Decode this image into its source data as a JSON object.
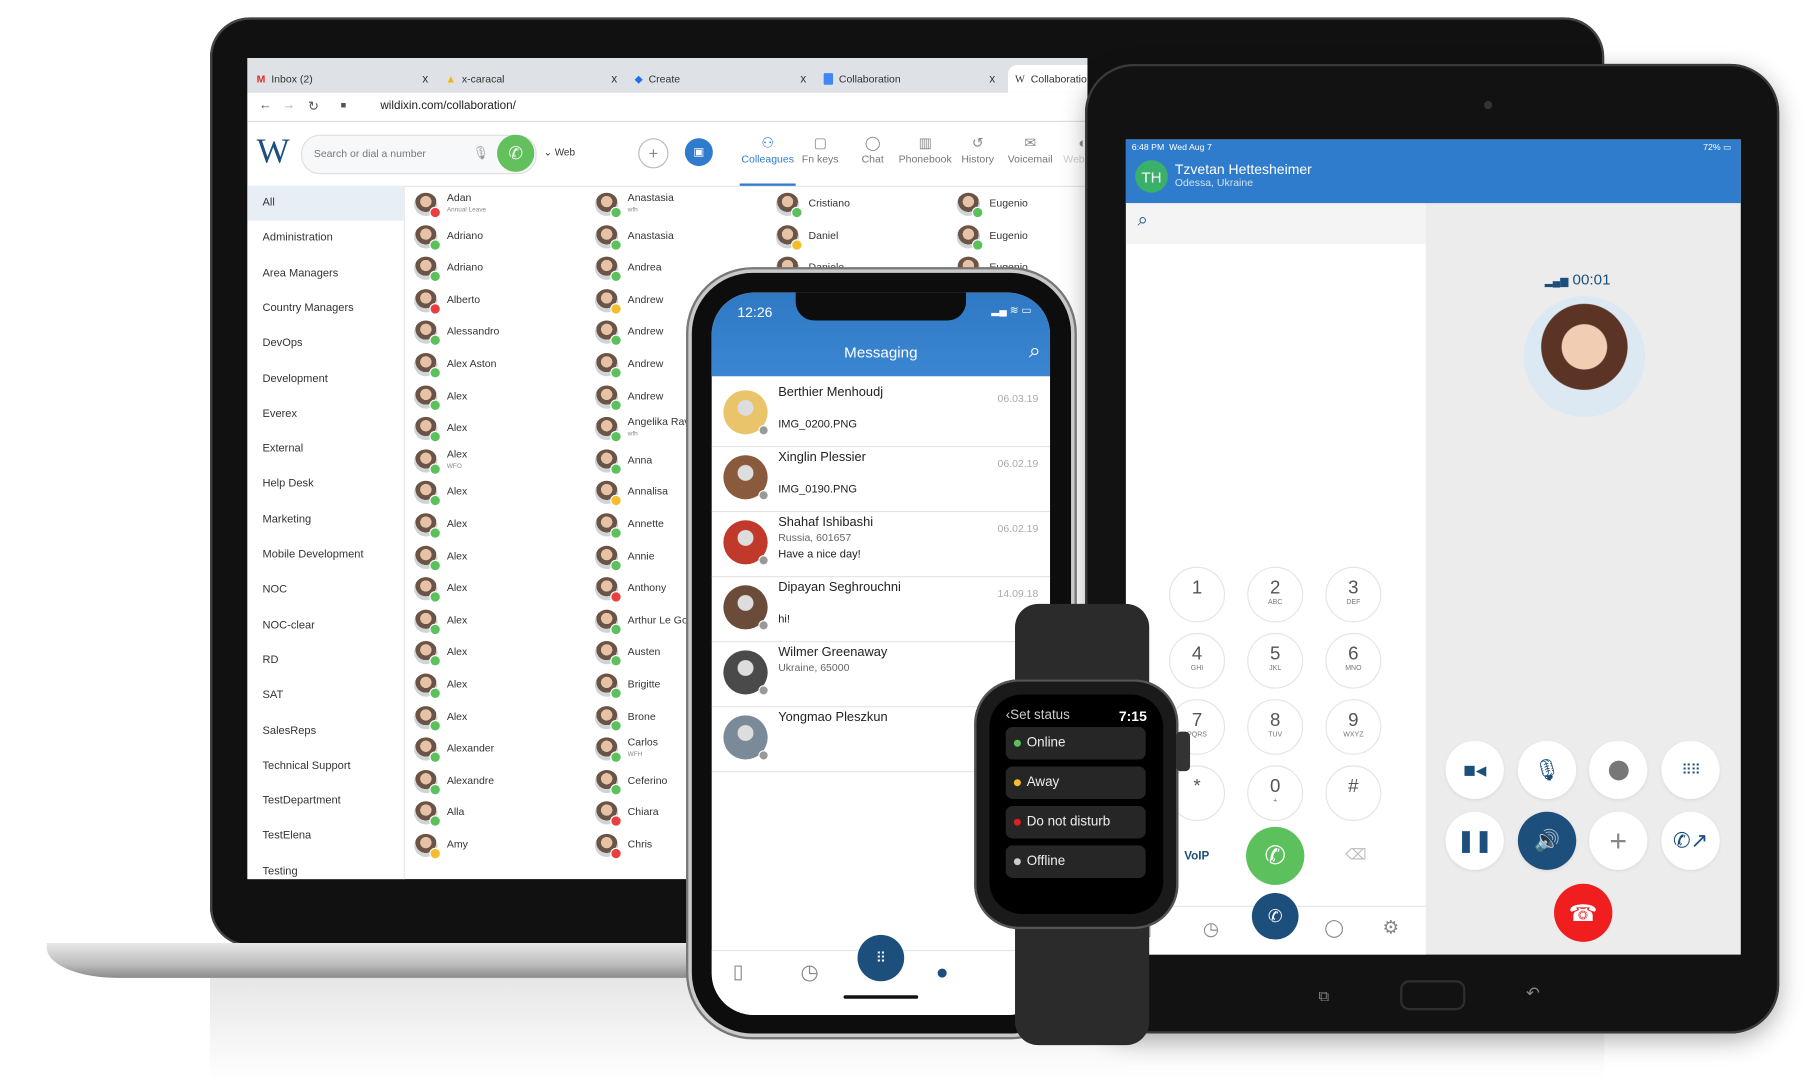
{
  "browser": {
    "tabs": [
      {
        "label": "Inbox (2)",
        "icon": "gmail-icon",
        "color": "#d93025"
      },
      {
        "label": "x-caracal",
        "icon": "drive-icon",
        "color": "#f4b400"
      },
      {
        "label": "Create",
        "icon": "diamond-icon",
        "color": "#1a73e8"
      },
      {
        "label": "Collaboration",
        "icon": "docs-icon",
        "color": "#4285f4"
      },
      {
        "label": "Collaboration",
        "icon": "wildix-icon",
        "color": "#333333"
      }
    ],
    "close_glyph": "x",
    "url": "wildixin.com/collaboration/"
  },
  "app": {
    "logo": "W",
    "search_placeholder": "Search or dial a number",
    "web_label": "Web",
    "nav": [
      {
        "label": "Colleagues",
        "icon": "people-icon",
        "active": true
      },
      {
        "label": "Fn keys",
        "icon": "fn-icon"
      },
      {
        "label": "Chat",
        "icon": "chat-icon"
      },
      {
        "label": "Phonebook",
        "icon": "book-icon"
      },
      {
        "label": "History",
        "icon": "history-icon"
      },
      {
        "label": "Voicemail",
        "icon": "voicemail-icon"
      },
      {
        "label": "Webinar",
        "icon": "webinar-icon"
      }
    ],
    "groups": [
      "All",
      "Administration",
      "Area Managers",
      "Country Managers",
      "DevOps",
      "Development",
      "Everex",
      "External",
      "Help Desk",
      "Marketing",
      "Mobile Development",
      "NOC",
      "NOC-clear",
      "RD",
      "SAT",
      "SalesReps",
      "Technical Support",
      "TestDepartment",
      "TestElena",
      "Testing"
    ],
    "status_colors": {
      "online": "#5cc15c",
      "away": "#f4bd2f",
      "busy": "#e84040"
    },
    "contacts": [
      [
        {
          "name": "Adan",
          "sub": "Annual Leave",
          "status": "busy"
        },
        {
          "name": "Adriano",
          "status": "online"
        },
        {
          "name": "Adriano",
          "status": "online"
        },
        {
          "name": "Alberto",
          "status": "busy"
        },
        {
          "name": "Alessandro",
          "status": "online"
        },
        {
          "name": "Alex Aston",
          "status": "online"
        },
        {
          "name": "Alex",
          "status": "online"
        },
        {
          "name": "Alex",
          "status": "online"
        },
        {
          "name": "Alex",
          "sub": "WFO",
          "status": "online"
        },
        {
          "name": "Alex",
          "status": "online"
        },
        {
          "name": "Alex",
          "status": "online"
        },
        {
          "name": "Alex",
          "status": "online"
        },
        {
          "name": "Alex",
          "status": "online"
        },
        {
          "name": "Alex",
          "status": "online"
        },
        {
          "name": "Alex",
          "status": "online"
        },
        {
          "name": "Alex",
          "status": "online"
        },
        {
          "name": "Alex",
          "status": "online"
        },
        {
          "name": "Alexander",
          "status": "online"
        },
        {
          "name": "Alexandre",
          "status": "online"
        },
        {
          "name": "Alla",
          "status": "online"
        },
        {
          "name": "Amy",
          "status": "away"
        }
      ],
      [
        {
          "name": "Anastasia",
          "sub": "wfh",
          "status": "online"
        },
        {
          "name": "Anastasia",
          "status": "online"
        },
        {
          "name": "Andrea",
          "status": "online"
        },
        {
          "name": "Andrew",
          "status": "away"
        },
        {
          "name": "Andrew",
          "status": "online"
        },
        {
          "name": "Andrew",
          "status": "online"
        },
        {
          "name": "Andrew",
          "status": "online"
        },
        {
          "name": "Angelika Rave",
          "sub": "wfh",
          "status": "online"
        },
        {
          "name": "Anna",
          "status": "online"
        },
        {
          "name": "Annalisa",
          "status": "away"
        },
        {
          "name": "Annette",
          "status": "online"
        },
        {
          "name": "Annie",
          "status": "online"
        },
        {
          "name": "Anthony",
          "status": "busy"
        },
        {
          "name": "Arthur Le Goff",
          "status": "online"
        },
        {
          "name": "Austen",
          "status": "online"
        },
        {
          "name": "Brigitte",
          "status": "online"
        },
        {
          "name": "Brone",
          "status": "online"
        },
        {
          "name": "Carlos",
          "sub": "WFH",
          "status": "online"
        },
        {
          "name": "Ceferino",
          "status": "online"
        },
        {
          "name": "Chiara",
          "status": "busy"
        },
        {
          "name": "Chris",
          "status": "busy"
        }
      ],
      [
        {
          "name": "Cristiano",
          "status": "online"
        },
        {
          "name": "Daniel",
          "status": "away"
        },
        {
          "name": "Daniele",
          "status": "online"
        }
      ],
      [
        {
          "name": "Eugenio",
          "status": "online"
        },
        {
          "name": "Eugenio",
          "status": "online"
        },
        {
          "name": "Eugenio",
          "status": "online"
        }
      ]
    ]
  },
  "phone": {
    "time": "12:26",
    "title": "Messaging",
    "messages": [
      {
        "name": "Berthier Menhoudj",
        "text": "IMG_0200.PNG",
        "date": "06.03.19",
        "color": "#e9c46a"
      },
      {
        "name": "Xinglin Plessier",
        "text": "IMG_0190.PNG",
        "date": "06.02.19",
        "color": "#8a5a3c"
      },
      {
        "name": "Shahaf Ishibashi",
        "sub": "Russia, 601657",
        "text": "Have a nice day!",
        "date": "06.02.19",
        "color": "#c0392b"
      },
      {
        "name": "Dipayan Seghrouchni",
        "text": "hi!",
        "date": "14.09.18",
        "color": "#6b4b3a"
      },
      {
        "name": "Wilmer Greenaway",
        "sub": "Ukraine, 65000",
        "text": "",
        "date": "",
        "color": "#4a4a4a"
      },
      {
        "name": "Yongmao Pleszkun",
        "text": "",
        "date": "",
        "color": "#7a8a99"
      }
    ],
    "bottom_nav": [
      "phone-icon",
      "clock-icon",
      "keypad-icon",
      "chat-icon",
      "gear-icon"
    ]
  },
  "watch": {
    "title": "Set status",
    "time": "7:15",
    "options": [
      {
        "label": "Online",
        "color": "#5cc15c"
      },
      {
        "label": "Away",
        "color": "#f4bd2f"
      },
      {
        "label": "Do not disturb",
        "color": "#e02020"
      },
      {
        "label": "Offline",
        "color": "#cccccc"
      }
    ]
  },
  "tablet": {
    "status_time": "6:48 PM",
    "status_date": "Wed Aug 7",
    "battery": "72%",
    "caller_initials": "TH",
    "caller_name": "Tzvetan Hettesheimer",
    "caller_location": "Odessa, Ukraine",
    "call_timer": "00:01",
    "voip_label": "VoIP",
    "keypad": [
      {
        "d": "1",
        "l": ""
      },
      {
        "d": "2",
        "l": "ABC"
      },
      {
        "d": "3",
        "l": "DEF"
      },
      {
        "d": "4",
        "l": "GHI"
      },
      {
        "d": "5",
        "l": "JKL"
      },
      {
        "d": "6",
        "l": "MNO"
      },
      {
        "d": "7",
        "l": "PQRS"
      },
      {
        "d": "8",
        "l": "TUV"
      },
      {
        "d": "9",
        "l": "WXYZ"
      },
      {
        "d": "*",
        "l": ""
      },
      {
        "d": "0",
        "l": "+"
      },
      {
        "d": "#",
        "l": ""
      }
    ],
    "accent": "#2f7ccc",
    "call_green": "#5cc15c",
    "hangup_red": "#f01e1e"
  }
}
